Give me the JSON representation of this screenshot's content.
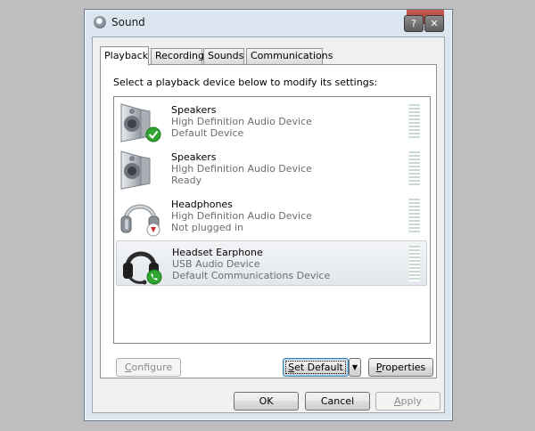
{
  "window": {
    "title": "Sound",
    "caption_help": "?",
    "caption_close": "✕"
  },
  "tabs": [
    {
      "label": "Playback",
      "active": true
    },
    {
      "label": "Recording",
      "active": false
    },
    {
      "label": "Sounds",
      "active": false
    },
    {
      "label": "Communications",
      "active": false
    }
  ],
  "instruction": "Select a playback device below to modify its settings:",
  "devices": [
    {
      "name": "Speakers",
      "driver": "High Definition Audio Device",
      "status": "Default Device",
      "icon": "speaker-icon",
      "badge": "green-check-badge"
    },
    {
      "name": "Speakers",
      "driver": "High Definition Audio Device",
      "status": "Ready",
      "icon": "speaker-icon",
      "badge": ""
    },
    {
      "name": "Headphones",
      "driver": "High Definition Audio Device",
      "status": "Not plugged in",
      "icon": "headphones-icon",
      "badge": "red-down-arrow-badge"
    },
    {
      "name": "Headset Earphone",
      "driver": "USB Audio Device",
      "status": "Default Communications Device",
      "icon": "headset-icon",
      "badge": "green-phone-badge",
      "selected": true
    }
  ],
  "buttons": {
    "configure_first": "C",
    "configure_rest": "onfigure",
    "set_default_first": "S",
    "set_default_rest": "et Default",
    "dropdown_glyph": "▼",
    "properties_first": "P",
    "properties_rest": "roperties",
    "ok": "OK",
    "cancel": "Cancel",
    "apply_first": "A",
    "apply_rest": "pply"
  },
  "colors": {
    "window_frame": "#dbe6f1",
    "selection": "#e3e7eb",
    "check_green": "#2fa532",
    "alert_red": "#d22a2a",
    "default_button_border": "#3c7fb1"
  }
}
